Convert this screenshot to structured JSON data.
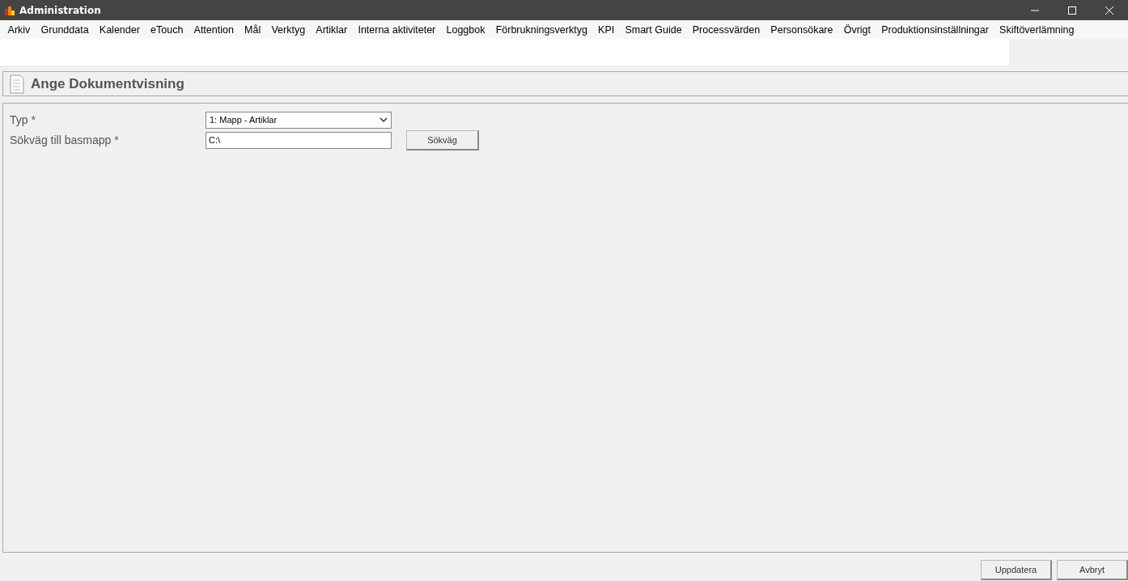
{
  "window": {
    "title": "Administration"
  },
  "menu": [
    "Arkiv",
    "Grunddata",
    "Kalender",
    "eTouch",
    "Attention",
    "Mål",
    "Verktyg",
    "Artiklar",
    "Interna aktiviteter",
    "Loggbok",
    "Förbrukningsverktyg",
    "KPI",
    "Smart Guide",
    "Processvärden",
    "Personsökare",
    "Övrigt",
    "Produktionsinställningar",
    "Skiftöverlämning"
  ],
  "heading": "Ange Dokumentvisning",
  "form": [
    {
      "kind": "select",
      "label": "Typ *",
      "value": "1: Mapp - Artiklar"
    },
    {
      "kind": "path",
      "label": "Sökväg till basmapp *",
      "value": "C:\\",
      "button": "Sökväg"
    }
  ],
  "buttons": [
    "Uppdatera",
    "Avbryt"
  ]
}
